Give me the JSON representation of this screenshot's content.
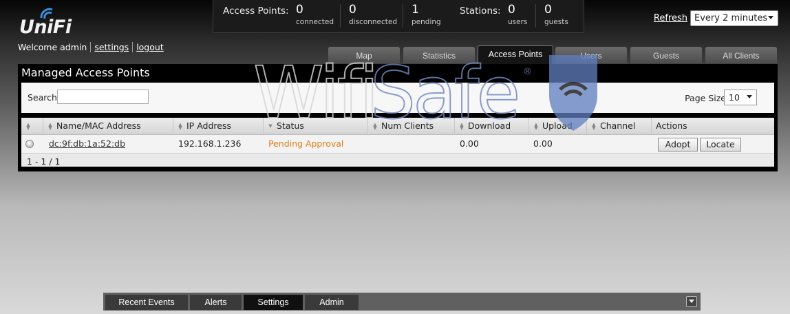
{
  "brand": {
    "logo_text": "UniFi"
  },
  "user_bar": {
    "welcome": "Welcome admin",
    "settings": "settings",
    "logout": "logout"
  },
  "stats": {
    "access_points_label": "Access Points:",
    "connected": {
      "value": "0",
      "label": "connected"
    },
    "disconnected": {
      "value": "0",
      "label": "disconnected"
    },
    "pending": {
      "value": "1",
      "label": "pending"
    },
    "stations_label": "Stations:",
    "users": {
      "value": "0",
      "label": "users"
    },
    "guests": {
      "value": "0",
      "label": "guests"
    }
  },
  "refresh": {
    "label": "Refresh",
    "selected": "Every 2 minutes"
  },
  "tabs": [
    {
      "label": "Map"
    },
    {
      "label": "Statistics"
    },
    {
      "label": "Access Points",
      "active": true
    },
    {
      "label": "Users"
    },
    {
      "label": "Guests"
    },
    {
      "label": "All Clients"
    }
  ],
  "panel": {
    "title": "Managed Access Points",
    "search_label": "Search",
    "search_value": "",
    "page_size_label": "Page Size",
    "page_size_value": "10",
    "columns": [
      "",
      "Name/MAC Address",
      "IP Address",
      "Status",
      "Num Clients",
      "Download",
      "Upload",
      "Channel",
      "Actions"
    ],
    "rows": [
      {
        "name": "dc:9f:db:1a:52:db",
        "ip": "192.168.1.236",
        "status": "Pending Approval",
        "num_clients": "",
        "download": "0.00",
        "upload": "0.00",
        "channel": "",
        "actions": [
          "Adopt",
          "Locate"
        ]
      }
    ],
    "pager": "1 - 1 / 1"
  },
  "watermark": {
    "text_gray": "Wifi",
    "text_blue": "Safe",
    "registered": "®"
  },
  "bottom_tabs": [
    {
      "label": "Recent Events"
    },
    {
      "label": "Alerts"
    },
    {
      "label": "Settings",
      "active": true
    },
    {
      "label": "Admin"
    }
  ],
  "colors": {
    "pending_status": "#e37e14",
    "watermark_blue": "#6f89bf",
    "watermark_gray": "#cfcfcf"
  }
}
